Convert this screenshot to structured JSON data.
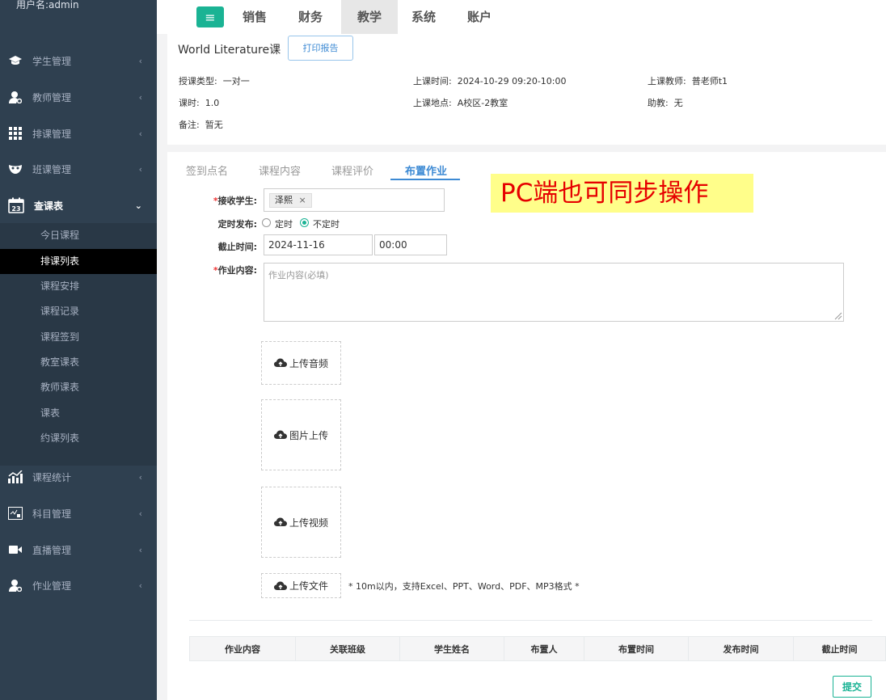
{
  "sidebar": {
    "user": "用户名:admin",
    "items": [
      {
        "label": "学生管理",
        "icon": "graduation-cap-icon"
      },
      {
        "label": "教师管理",
        "icon": "teacher-icon"
      },
      {
        "label": "排课管理",
        "icon": "grid-icon"
      },
      {
        "label": "班课管理",
        "icon": "mask-icon"
      },
      {
        "label": "查课表",
        "icon": "calendar-icon"
      },
      {
        "label": "课程统计",
        "icon": "bar-chart-icon"
      },
      {
        "label": "科目管理",
        "icon": "formula-icon"
      },
      {
        "label": "直播管理",
        "icon": "video-icon"
      },
      {
        "label": "作业管理",
        "icon": "user-task-icon"
      }
    ],
    "calendar_day": "23",
    "submenu": [
      "今日课程",
      "排课列表",
      "课程安排",
      "课程记录",
      "课程签到",
      "教室课表",
      "教师课表",
      "课表",
      "约课列表"
    ],
    "active_sub": "排课列表"
  },
  "topbar": {
    "tabs": [
      "销售",
      "财务",
      "教学",
      "系统",
      "账户"
    ],
    "active": "教学"
  },
  "course": {
    "title": "World Literature课",
    "print_button": "打印报告",
    "info": {
      "type_label": "授课类型:",
      "type_value": "一对一",
      "time_label": "上课时间:",
      "time_value": "2024-10-29 09:20-10:00",
      "teacher_label": "上课教师:",
      "teacher_value": "普老师t1",
      "hours_label": "课时:",
      "hours_value": "1.0",
      "place_label": "上课地点:",
      "place_value": "A校区-2教室",
      "assistant_label": "助教:",
      "assistant_value": "无",
      "note_label": "备注:",
      "note_value": "暂无"
    }
  },
  "tabs": [
    "签到点名",
    "课程内容",
    "课程评价",
    "布置作业"
  ],
  "active_tab": "布置作业",
  "form": {
    "student_label": "接收学生:",
    "student_chip": "泽熙",
    "chip_remove": "×",
    "required_mark": "*",
    "publish_label": "定时发布:",
    "publish_options": [
      "定时",
      "不定时"
    ],
    "publish_selected": "不定时",
    "deadline_label": "截止时间:",
    "deadline_date": "2024-11-16",
    "deadline_time": "00:00",
    "content_label": "作业内容:",
    "content_placeholder": "作业内容(必填)",
    "uploads": {
      "audio": "上传音频",
      "image": "图片上传",
      "video": "上传视频",
      "file": "上传文件"
    },
    "file_hint": "* 10m以内，支持Excel、PPT、Word、PDF、MP3格式 *"
  },
  "table": {
    "headers": [
      "作业内容",
      "关联班级",
      "学生姓名",
      "布置人",
      "布置时间",
      "发布时间",
      "截止时间"
    ]
  },
  "submit_label": "提交",
  "callout": "PC端也可同步操作"
}
